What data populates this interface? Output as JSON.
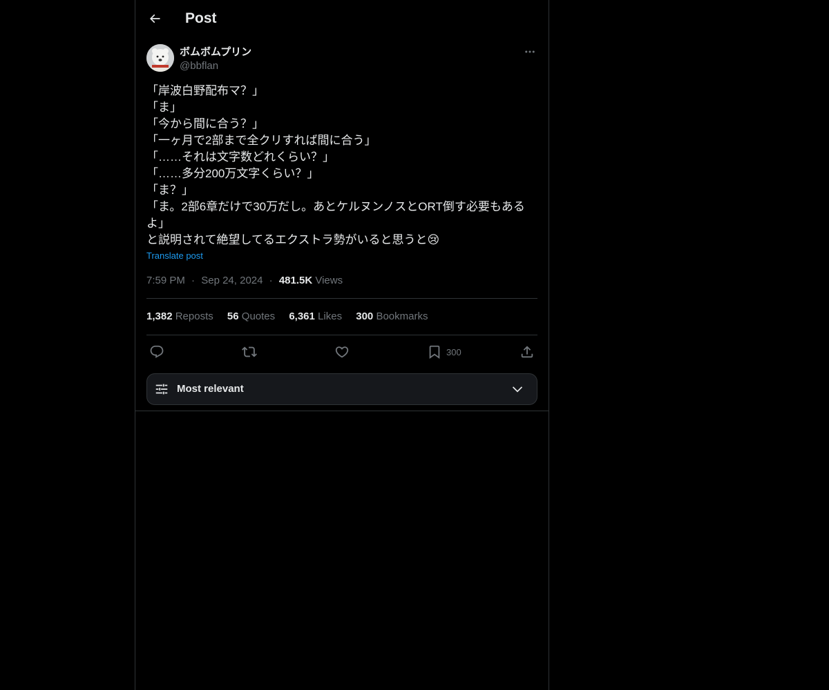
{
  "header": {
    "title": "Post"
  },
  "author": {
    "name": "ボムボムプリン",
    "handle": "@bbflan"
  },
  "post": {
    "lines": [
      "「岸波白野配布マ？」",
      "「ま」",
      "「今から間に合う？」",
      "「一ヶ月で2部まで全クリすれば間に合う」",
      "「……それは文字数どれくらい？」",
      "「……多分200万文字くらい？」",
      "「ま？」",
      "「ま。2部6章だけで30万だし。あとケルヌンノスとORT倒す必要もある",
      "よ」",
      "と説明されて絶望してるエクストラ勢がいると思うと😢"
    ],
    "translate_label": "Translate post"
  },
  "meta": {
    "time": "7:59 PM",
    "date": "Sep 24, 2024",
    "views_count": "481.5K",
    "views_label": "Views",
    "separator": "·"
  },
  "stats": {
    "reposts_count": "1,382",
    "reposts_label": "Reposts",
    "quotes_count": "56",
    "quotes_label": "Quotes",
    "likes_count": "6,361",
    "likes_label": "Likes",
    "bookmarks_count": "300",
    "bookmarks_label": "Bookmarks"
  },
  "actions": {
    "bookmark_count": "300"
  },
  "sort": {
    "label": "Most relevant"
  },
  "colors": {
    "background": "#000000",
    "text": "#e7e9ea",
    "muted": "#71767b",
    "link": "#1d9bf0",
    "border": "#2f3336"
  },
  "icons": [
    "back-arrow-icon",
    "more-icon",
    "reply-icon",
    "repost-icon",
    "like-icon",
    "bookmark-icon",
    "share-icon",
    "sliders-icon",
    "chevron-down-icon"
  ]
}
